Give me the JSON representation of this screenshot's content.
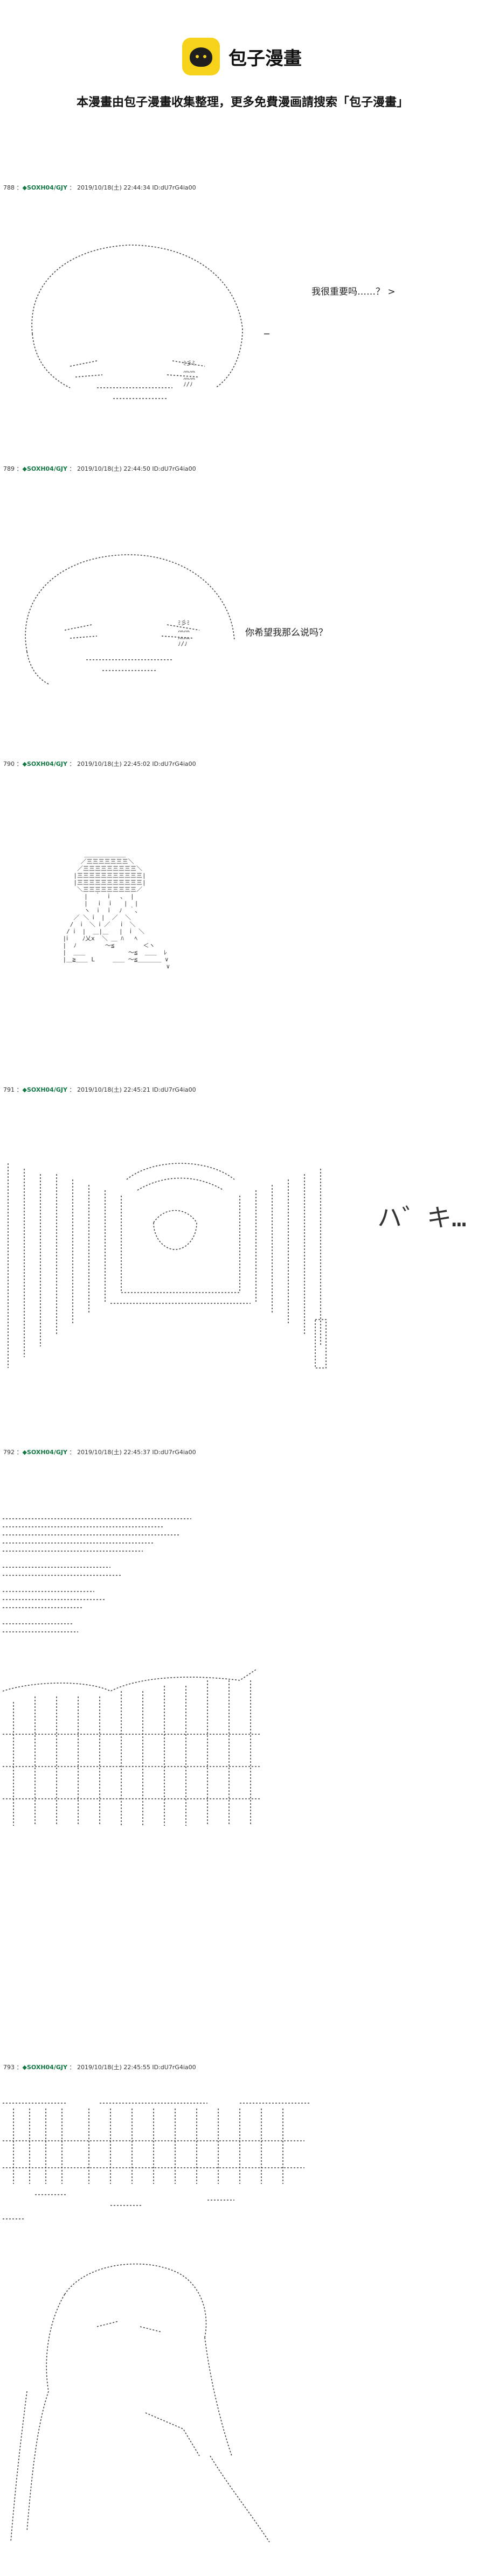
{
  "site": {
    "logo_name": "包子漫畫",
    "notice": "本漫畫由包子漫畫收集整理，更多免費漫画請搜索「包子漫畫」"
  },
  "colors": {
    "logo_yellow": "#f7d21a",
    "name_green": "#117743"
  },
  "posts": [
    {
      "number": "788",
      "name": "◆SOXH04/GJY",
      "datetime": "2019/10/18(土) 22:44:34",
      "id": "ID:dU7rG4ia00",
      "speech": "我很重要吗……？ >"
    },
    {
      "number": "789",
      "name": "◆SOXH04/GJY",
      "datetime": "2019/10/18(土) 22:44:50",
      "id": "ID:dU7rG4ia00",
      "speech": "你希望我那么说吗？"
    },
    {
      "number": "790",
      "name": "◆SOXH04/GJY",
      "datetime": "2019/10/18(土) 22:45:02",
      "id": "ID:dU7rG4ia00",
      "speech": ""
    },
    {
      "number": "791",
      "name": "◆SOXH04/GJY",
      "datetime": "2019/10/18(土) 22:45:21",
      "id": "ID:dU7rG4ia00",
      "speech": "ハ゛キ…"
    },
    {
      "number": "792",
      "name": "◆SOXH04/GJY",
      "datetime": "2019/10/18(土) 22:45:37",
      "id": "ID:dU7rG4ia00",
      "speech": ""
    },
    {
      "number": "793",
      "name": "◆SOXH04/GJY",
      "datetime": "2019/10/18(土) 22:45:55",
      "id": "ID:dU7rG4ia00",
      "speech": ""
    }
  ]
}
